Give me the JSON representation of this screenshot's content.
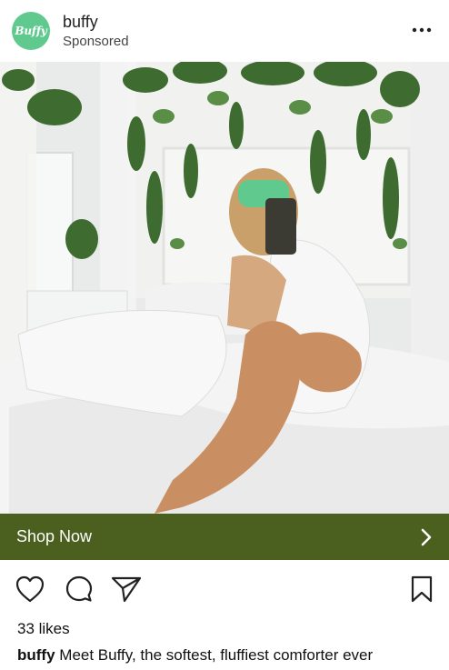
{
  "post": {
    "avatar_text": "Buffy",
    "account_name": "buffy",
    "sponsored_label": "Sponsored"
  },
  "icons": {
    "more": "more-horizontal-icon",
    "like": "heart-icon",
    "comment": "comment-icon",
    "share": "send-icon",
    "save": "bookmark-icon",
    "cta_arrow": "chevron-right-icon"
  },
  "cta": {
    "label": "Shop Now"
  },
  "engagement": {
    "likes_text": "33 likes"
  },
  "caption": {
    "username": "buffy",
    "text": "Meet Buffy, the softest, fluffiest comforter ever"
  },
  "colors": {
    "avatar_bg": "#5fc98e",
    "cta_bg": "#4b5f1f",
    "cta_text": "#ffffff"
  }
}
